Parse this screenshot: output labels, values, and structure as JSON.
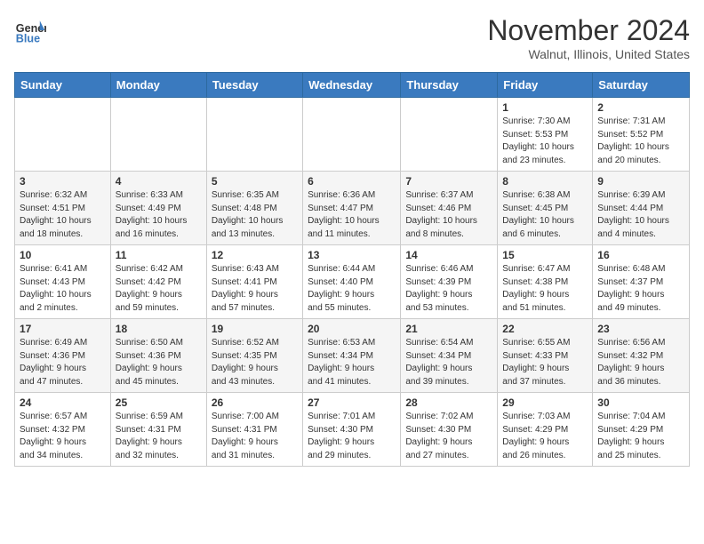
{
  "header": {
    "logo_general": "General",
    "logo_blue": "Blue",
    "month_title": "November 2024",
    "location": "Walnut, Illinois, United States"
  },
  "weekdays": [
    "Sunday",
    "Monday",
    "Tuesday",
    "Wednesday",
    "Thursday",
    "Friday",
    "Saturday"
  ],
  "weeks": [
    [
      {
        "day": "",
        "info": ""
      },
      {
        "day": "",
        "info": ""
      },
      {
        "day": "",
        "info": ""
      },
      {
        "day": "",
        "info": ""
      },
      {
        "day": "",
        "info": ""
      },
      {
        "day": "1",
        "info": "Sunrise: 7:30 AM\nSunset: 5:53 PM\nDaylight: 10 hours\nand 23 minutes."
      },
      {
        "day": "2",
        "info": "Sunrise: 7:31 AM\nSunset: 5:52 PM\nDaylight: 10 hours\nand 20 minutes."
      }
    ],
    [
      {
        "day": "3",
        "info": "Sunrise: 6:32 AM\nSunset: 4:51 PM\nDaylight: 10 hours\nand 18 minutes."
      },
      {
        "day": "4",
        "info": "Sunrise: 6:33 AM\nSunset: 4:49 PM\nDaylight: 10 hours\nand 16 minutes."
      },
      {
        "day": "5",
        "info": "Sunrise: 6:35 AM\nSunset: 4:48 PM\nDaylight: 10 hours\nand 13 minutes."
      },
      {
        "day": "6",
        "info": "Sunrise: 6:36 AM\nSunset: 4:47 PM\nDaylight: 10 hours\nand 11 minutes."
      },
      {
        "day": "7",
        "info": "Sunrise: 6:37 AM\nSunset: 4:46 PM\nDaylight: 10 hours\nand 8 minutes."
      },
      {
        "day": "8",
        "info": "Sunrise: 6:38 AM\nSunset: 4:45 PM\nDaylight: 10 hours\nand 6 minutes."
      },
      {
        "day": "9",
        "info": "Sunrise: 6:39 AM\nSunset: 4:44 PM\nDaylight: 10 hours\nand 4 minutes."
      }
    ],
    [
      {
        "day": "10",
        "info": "Sunrise: 6:41 AM\nSunset: 4:43 PM\nDaylight: 10 hours\nand 2 minutes."
      },
      {
        "day": "11",
        "info": "Sunrise: 6:42 AM\nSunset: 4:42 PM\nDaylight: 9 hours\nand 59 minutes."
      },
      {
        "day": "12",
        "info": "Sunrise: 6:43 AM\nSunset: 4:41 PM\nDaylight: 9 hours\nand 57 minutes."
      },
      {
        "day": "13",
        "info": "Sunrise: 6:44 AM\nSunset: 4:40 PM\nDaylight: 9 hours\nand 55 minutes."
      },
      {
        "day": "14",
        "info": "Sunrise: 6:46 AM\nSunset: 4:39 PM\nDaylight: 9 hours\nand 53 minutes."
      },
      {
        "day": "15",
        "info": "Sunrise: 6:47 AM\nSunset: 4:38 PM\nDaylight: 9 hours\nand 51 minutes."
      },
      {
        "day": "16",
        "info": "Sunrise: 6:48 AM\nSunset: 4:37 PM\nDaylight: 9 hours\nand 49 minutes."
      }
    ],
    [
      {
        "day": "17",
        "info": "Sunrise: 6:49 AM\nSunset: 4:36 PM\nDaylight: 9 hours\nand 47 minutes."
      },
      {
        "day": "18",
        "info": "Sunrise: 6:50 AM\nSunset: 4:36 PM\nDaylight: 9 hours\nand 45 minutes."
      },
      {
        "day": "19",
        "info": "Sunrise: 6:52 AM\nSunset: 4:35 PM\nDaylight: 9 hours\nand 43 minutes."
      },
      {
        "day": "20",
        "info": "Sunrise: 6:53 AM\nSunset: 4:34 PM\nDaylight: 9 hours\nand 41 minutes."
      },
      {
        "day": "21",
        "info": "Sunrise: 6:54 AM\nSunset: 4:34 PM\nDaylight: 9 hours\nand 39 minutes."
      },
      {
        "day": "22",
        "info": "Sunrise: 6:55 AM\nSunset: 4:33 PM\nDaylight: 9 hours\nand 37 minutes."
      },
      {
        "day": "23",
        "info": "Sunrise: 6:56 AM\nSunset: 4:32 PM\nDaylight: 9 hours\nand 36 minutes."
      }
    ],
    [
      {
        "day": "24",
        "info": "Sunrise: 6:57 AM\nSunset: 4:32 PM\nDaylight: 9 hours\nand 34 minutes."
      },
      {
        "day": "25",
        "info": "Sunrise: 6:59 AM\nSunset: 4:31 PM\nDaylight: 9 hours\nand 32 minutes."
      },
      {
        "day": "26",
        "info": "Sunrise: 7:00 AM\nSunset: 4:31 PM\nDaylight: 9 hours\nand 31 minutes."
      },
      {
        "day": "27",
        "info": "Sunrise: 7:01 AM\nSunset: 4:30 PM\nDaylight: 9 hours\nand 29 minutes."
      },
      {
        "day": "28",
        "info": "Sunrise: 7:02 AM\nSunset: 4:30 PM\nDaylight: 9 hours\nand 27 minutes."
      },
      {
        "day": "29",
        "info": "Sunrise: 7:03 AM\nSunset: 4:29 PM\nDaylight: 9 hours\nand 26 minutes."
      },
      {
        "day": "30",
        "info": "Sunrise: 7:04 AM\nSunset: 4:29 PM\nDaylight: 9 hours\nand 25 minutes."
      }
    ]
  ]
}
